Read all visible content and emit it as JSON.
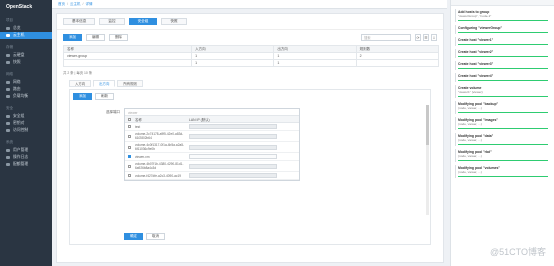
{
  "app": {
    "logo": "OpenStack"
  },
  "sidebar": {
    "groups": [
      {
        "title": "项目",
        "items": [
          {
            "label": "总览"
          },
          {
            "label": "云主机",
            "active": true
          }
        ]
      },
      {
        "title": "存储",
        "items": [
          {
            "label": "云硬盘"
          },
          {
            "label": "快照"
          }
        ]
      },
      {
        "title": "网络",
        "items": [
          {
            "label": "网络"
          },
          {
            "label": "路由"
          },
          {
            "label": "负载均衡"
          }
        ]
      },
      {
        "title": "安全",
        "items": [
          {
            "label": "安全组"
          },
          {
            "label": "密钥对"
          },
          {
            "label": "访问控制"
          }
        ]
      },
      {
        "title": "系统",
        "items": [
          {
            "label": "用户管理"
          },
          {
            "label": "操作日志"
          },
          {
            "label": "配额管理"
          }
        ]
      }
    ]
  },
  "breadcrumb": [
    "首页",
    "云主机",
    "详情"
  ],
  "tabs": [
    {
      "label": "基本信息"
    },
    {
      "label": "监控"
    },
    {
      "label": "安全组",
      "active": true
    },
    {
      "label": "快照"
    }
  ],
  "toolbar": {
    "add_label": "添加",
    "edit_label": "编辑",
    "delete_label": "删除",
    "search_placeholder": "搜索"
  },
  "table": {
    "headers": [
      "名称",
      "入方向",
      "出方向",
      "规则数"
    ],
    "rows": [
      [
        "viewer-group",
        "1",
        "1",
        "2"
      ],
      [
        "",
        "1",
        "1",
        ""
      ]
    ],
    "footer": "共 2 条 | 每页 10 条"
  },
  "subtabs": [
    {
      "label": "入方向"
    },
    {
      "label": "出方向",
      "active": true
    },
    {
      "label": "所有规则"
    }
  ],
  "subtoolbar": {
    "add_label": "添加",
    "refresh_label": "刷新"
  },
  "form": {
    "label": "选择端口",
    "picker_placeholder": "viewer",
    "col_name": "名称",
    "col_ip": "LAN IP (默认)",
    "rows": [
      {
        "name": "test",
        "checked": false,
        "gray": true
      },
      {
        "name": "volume-2c74178-a9f5-42e0-a83d-61f2802b64",
        "checked": false,
        "gray": true
      },
      {
        "name": "volume-4c0f1317-0f1a-4b5a-a2a5-6f11036c9e0b",
        "checked": false,
        "gray": true
      },
      {
        "name": "viewer-vm",
        "checked": true,
        "gray": false
      },
      {
        "name": "volume-4b07f1b-4380-4290-81d1-6a926b8a4c3d",
        "checked": false,
        "gray": true
      },
      {
        "name": "volume-f427dfe-a2c3-4090-ac19",
        "checked": false,
        "gray": true
      }
    ],
    "submit_label": "确定",
    "cancel_label": "取消"
  },
  "activity": [
    {
      "title": "Add hosts to group",
      "sub": "\"viewerGroup\", \"node-1\""
    },
    {
      "title": "Configuring \"viewerGroup\"",
      "sub": ""
    },
    {
      "title": "Create host \"viewer1\"",
      "sub": ""
    },
    {
      "title": "Create host \"viewer2\"",
      "sub": ""
    },
    {
      "title": "Create host \"viewer3\"",
      "sub": ""
    },
    {
      "title": "Create host \"viewer4\"",
      "sub": ""
    },
    {
      "title": "Create volume",
      "sub": "\"viewer1\" (viewer)"
    },
    {
      "title": "Modifying pool \"backup\"",
      "sub": "(node, viewer, ...)"
    },
    {
      "title": "Modifying pool \"images\"",
      "sub": "(node, viewer, ...)"
    },
    {
      "title": "Modifying pool \"data\"",
      "sub": "(node, viewer, ...)"
    },
    {
      "title": "Modifying pool \"rbd\"",
      "sub": "(node, viewer, ...)"
    },
    {
      "title": "Modifying pool \"volumes\"",
      "sub": "(node, viewer, ...)"
    }
  ],
  "watermark": "@51CTO博客"
}
